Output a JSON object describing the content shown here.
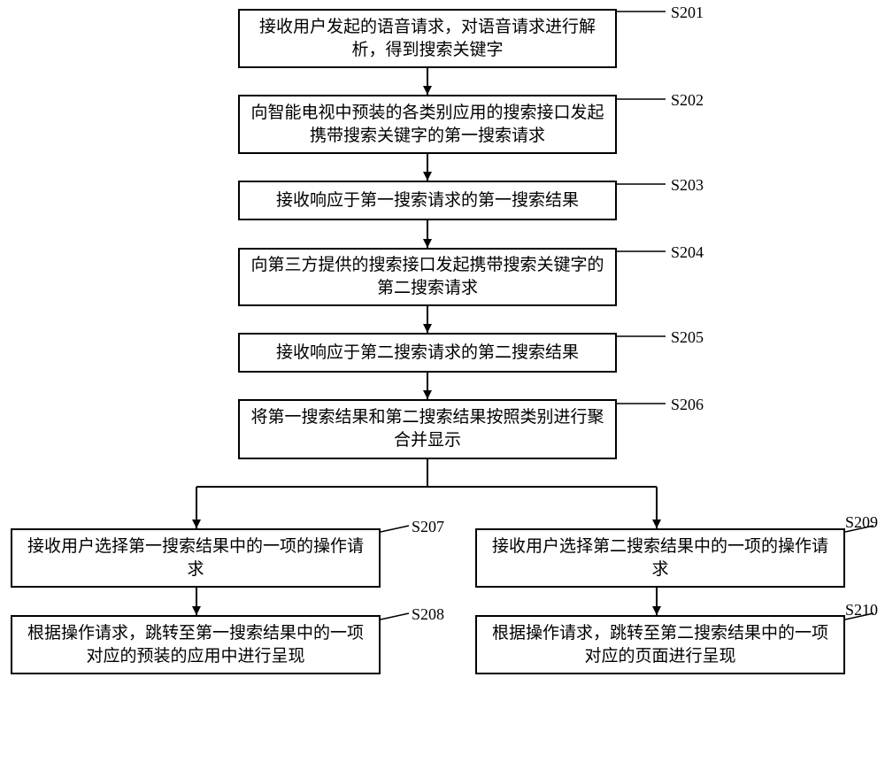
{
  "steps": {
    "s201": {
      "id": "S201",
      "text": "接收用户发起的语音请求，对语音请求进行解析，得到搜索关键字"
    },
    "s202": {
      "id": "S202",
      "text": "向智能电视中预装的各类别应用的搜索接口发起携带搜索关键字的第一搜索请求"
    },
    "s203": {
      "id": "S203",
      "text": "接收响应于第一搜索请求的第一搜索结果"
    },
    "s204": {
      "id": "S204",
      "text": "向第三方提供的搜索接口发起携带搜索关键字的第二搜索请求"
    },
    "s205": {
      "id": "S205",
      "text": "接收响应于第二搜索请求的第二搜索结果"
    },
    "s206": {
      "id": "S206",
      "text": "将第一搜索结果和第二搜索结果按照类别进行聚合并显示"
    },
    "s207": {
      "id": "S207",
      "text": "接收用户选择第一搜索结果中的一项的操作请求"
    },
    "s208": {
      "id": "S208",
      "text": "根据操作请求，跳转至第一搜索结果中的一项对应的预装的应用中进行呈现"
    },
    "s209": {
      "id": "S209",
      "text": "接收用户选择第二搜索结果中的一项的操作请求"
    },
    "s210": {
      "id": "S210",
      "text": "根据操作请求，跳转至第二搜索结果中的一项对应的页面进行呈现"
    }
  },
  "chart_data": {
    "type": "flowchart",
    "nodes": [
      {
        "id": "S201",
        "label": "接收用户发起的语音请求，对语音请求进行解析，得到搜索关键字"
      },
      {
        "id": "S202",
        "label": "向智能电视中预装的各类别应用的搜索接口发起携带搜索关键字的第一搜索请求"
      },
      {
        "id": "S203",
        "label": "接收响应于第一搜索请求的第一搜索结果"
      },
      {
        "id": "S204",
        "label": "向第三方提供的搜索接口发起携带搜索关键字的第二搜索请求"
      },
      {
        "id": "S205",
        "label": "接收响应于第二搜索请求的第二搜索结果"
      },
      {
        "id": "S206",
        "label": "将第一搜索结果和第二搜索结果按照类别进行聚合并显示"
      },
      {
        "id": "S207",
        "label": "接收用户选择第一搜索结果中的一项的操作请求"
      },
      {
        "id": "S208",
        "label": "根据操作请求，跳转至第一搜索结果中的一项对应的预装的应用中进行呈现"
      },
      {
        "id": "S209",
        "label": "接收用户选择第二搜索结果中的一项的操作请求"
      },
      {
        "id": "S210",
        "label": "根据操作请求，跳转至第二搜索结果中的一项对应的页面进行呈现"
      }
    ],
    "edges": [
      {
        "from": "S201",
        "to": "S202"
      },
      {
        "from": "S202",
        "to": "S203"
      },
      {
        "from": "S203",
        "to": "S204"
      },
      {
        "from": "S204",
        "to": "S205"
      },
      {
        "from": "S205",
        "to": "S206"
      },
      {
        "from": "S206",
        "to": "S207"
      },
      {
        "from": "S206",
        "to": "S209"
      },
      {
        "from": "S207",
        "to": "S208"
      },
      {
        "from": "S209",
        "to": "S210"
      }
    ]
  }
}
